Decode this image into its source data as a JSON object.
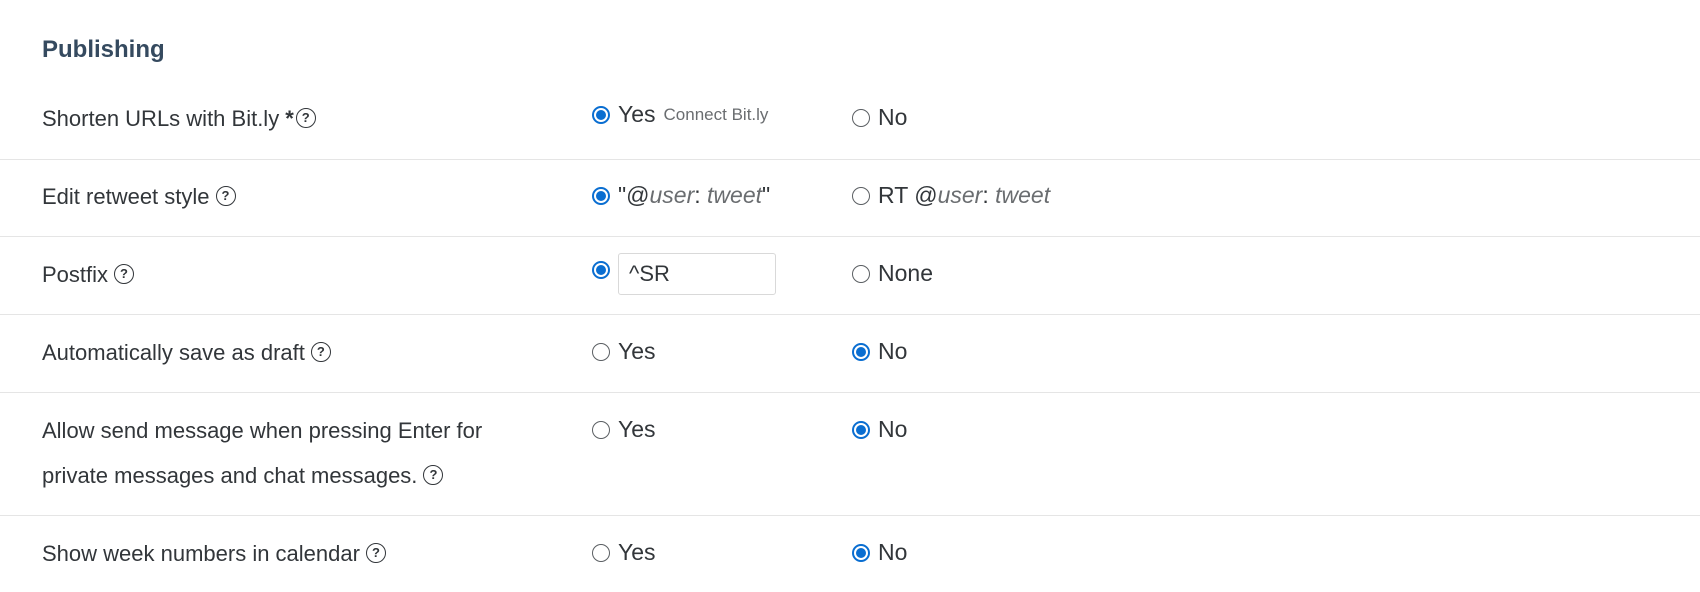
{
  "section": {
    "title": "Publishing"
  },
  "rows": {
    "bitly": {
      "label": "Shorten URLs with Bit.ly",
      "required_mark": "*",
      "help": "?",
      "yes_label": "Yes",
      "connect_label": "Connect Bit.ly",
      "no_label": "No",
      "selected": "yes"
    },
    "retweet": {
      "label": "Edit retweet style",
      "help": "?",
      "opt1_prefix": "\"@",
      "opt1_user": "user",
      "opt1_sep": ": ",
      "opt1_tweet": "tweet",
      "opt1_suffix": "\"",
      "opt2_prefix": "RT @",
      "opt2_user": "user",
      "opt2_sep": ": ",
      "opt2_tweet": "tweet",
      "selected": "opt1"
    },
    "postfix": {
      "label": "Postfix",
      "help": "?",
      "input_value": "^SR",
      "none_label": "None",
      "selected": "custom"
    },
    "draft": {
      "label": "Automatically save as draft",
      "help": "?",
      "yes_label": "Yes",
      "no_label": "No",
      "selected": "no"
    },
    "enter_send": {
      "label_line1": "Allow send message when pressing Enter for",
      "label_line2": "private messages and chat messages.",
      "help": "?",
      "yes_label": "Yes",
      "no_label": "No",
      "selected": "no"
    },
    "week_numbers": {
      "label": "Show week numbers in calendar",
      "help": "?",
      "yes_label": "Yes",
      "no_label": "No",
      "selected": "no"
    }
  },
  "colors": {
    "accent": "#0a6ed1",
    "text": "#32363a",
    "title": "#354a5f",
    "divider": "#e5e5e5"
  }
}
